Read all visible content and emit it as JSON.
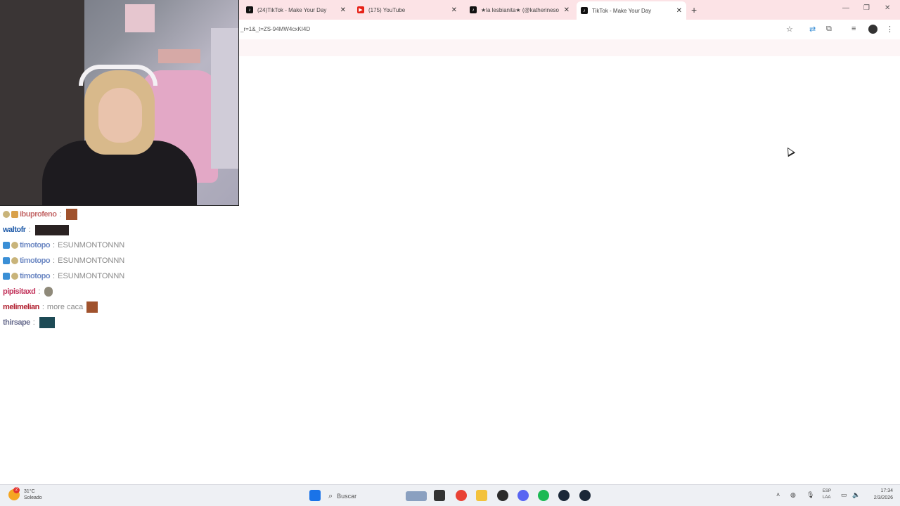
{
  "tabs": [
    {
      "title": "(24)TikTok - Make Your Day",
      "icon": "tiktok-icon"
    },
    {
      "title": "(175) YouTube",
      "icon": "youtube-icon"
    },
    {
      "title": "★la lesbianita★ (@katherineso",
      "icon": "tiktok-icon"
    },
    {
      "title": "TikTok - Make Your Day",
      "icon": "tiktok-icon"
    }
  ],
  "url": "_r=1&_t=ZS-94MW4cxKI4D",
  "chat": [
    {
      "user": "ibuprofeno",
      "text": "",
      "user_color": "#b03a3a"
    },
    {
      "user": "waltofr",
      "text": "",
      "user_color": "#1e5aa8"
    },
    {
      "user": "timotopo",
      "text": "ESUNMONTONNN",
      "user_color": "#4c6fb0"
    },
    {
      "user": "timotopo",
      "text": "ESUNMONTONNN",
      "user_color": "#4c6fb0"
    },
    {
      "user": "timotopo",
      "text": "ESUNMONTONNN",
      "user_color": "#4c6fb0"
    },
    {
      "user": "pipisitaxd",
      "text": "",
      "user_color": "#c2325a"
    },
    {
      "user": "melimelian",
      "text": "more caca",
      "user_color": "#b01e2e"
    },
    {
      "user": "thirsape",
      "text": "",
      "user_color": "#6b6f90"
    }
  ],
  "weather": {
    "temp": "31°C",
    "condition": "Soleado",
    "alert_count": "2"
  },
  "taskbar": {
    "search_placeholder": "Buscar"
  },
  "language": {
    "line1": "ESP",
    "line2": "LAA"
  },
  "clock": {
    "time": "17:34",
    "date": "2/3/2026"
  },
  "colors": {
    "tab_strip": "#fce3e6",
    "taskbar": "#eef0f4"
  }
}
